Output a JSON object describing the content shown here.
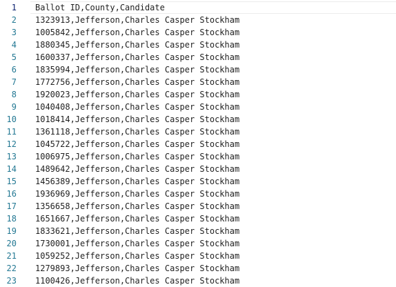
{
  "editor": {
    "lines": [
      {
        "num": "1",
        "text": "Ballot ID,County,Candidate"
      },
      {
        "num": "2",
        "text": "1323913,Jefferson,Charles Casper Stockham"
      },
      {
        "num": "3",
        "text": "1005842,Jefferson,Charles Casper Stockham"
      },
      {
        "num": "4",
        "text": "1880345,Jefferson,Charles Casper Stockham"
      },
      {
        "num": "5",
        "text": "1600337,Jefferson,Charles Casper Stockham"
      },
      {
        "num": "6",
        "text": "1835994,Jefferson,Charles Casper Stockham"
      },
      {
        "num": "7",
        "text": "1772756,Jefferson,Charles Casper Stockham"
      },
      {
        "num": "8",
        "text": "1920023,Jefferson,Charles Casper Stockham"
      },
      {
        "num": "9",
        "text": "1040408,Jefferson,Charles Casper Stockham"
      },
      {
        "num": "10",
        "text": "1018414,Jefferson,Charles Casper Stockham"
      },
      {
        "num": "11",
        "text": "1361118,Jefferson,Charles Casper Stockham"
      },
      {
        "num": "12",
        "text": "1045722,Jefferson,Charles Casper Stockham"
      },
      {
        "num": "13",
        "text": "1006975,Jefferson,Charles Casper Stockham"
      },
      {
        "num": "14",
        "text": "1489642,Jefferson,Charles Casper Stockham"
      },
      {
        "num": "15",
        "text": "1456389,Jefferson,Charles Casper Stockham"
      },
      {
        "num": "16",
        "text": "1936969,Jefferson,Charles Casper Stockham"
      },
      {
        "num": "17",
        "text": "1356658,Jefferson,Charles Casper Stockham"
      },
      {
        "num": "18",
        "text": "1651667,Jefferson,Charles Casper Stockham"
      },
      {
        "num": "19",
        "text": "1833621,Jefferson,Charles Casper Stockham"
      },
      {
        "num": "20",
        "text": "1730001,Jefferson,Charles Casper Stockham"
      },
      {
        "num": "21",
        "text": "1059252,Jefferson,Charles Casper Stockham"
      },
      {
        "num": "22",
        "text": "1279893,Jefferson,Charles Casper Stockham"
      },
      {
        "num": "23",
        "text": "1100426,Jefferson,Charles Casper Stockham"
      }
    ]
  }
}
